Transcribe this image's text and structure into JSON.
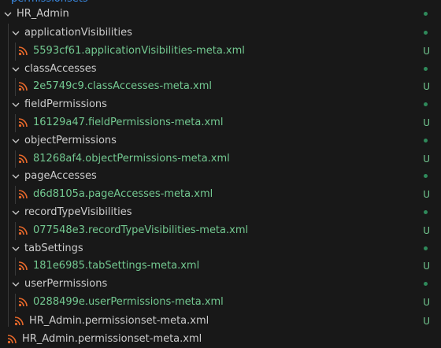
{
  "explorer": {
    "cutoff_label": "permissionsets",
    "root_folder": {
      "label": "HR_Admin",
      "icon": "chevron-down-icon"
    },
    "groups": [
      {
        "folder": "applicationVisibilities",
        "file": "5593cf61.applicationVisibilities-meta.xml",
        "status": "U"
      },
      {
        "folder": "classAccesses",
        "file": "2e5749c9.classAccesses-meta.xml",
        "status": "U"
      },
      {
        "folder": "fieldPermissions",
        "file": "16129a47.fieldPermissions-meta.xml",
        "status": "U"
      },
      {
        "folder": "objectPermissions",
        "file": "81268af4.objectPermissions-meta.xml",
        "status": "U"
      },
      {
        "folder": "pageAccesses",
        "file": "d6d8105a.pageAccesses-meta.xml",
        "status": "U"
      },
      {
        "folder": "recordTypeVisibilities",
        "file": "077548e3.recordTypeVisibilities-meta.xml",
        "status": "U"
      },
      {
        "folder": "tabSettings",
        "file": "181e6985.tabSettings-meta.xml",
        "status": "U"
      },
      {
        "folder": "userPermissions",
        "file": "0288499e.userPermissions-meta.xml",
        "status": "U"
      }
    ],
    "root_file": {
      "label": "HR_Admin.permissionset-meta.xml",
      "status": "U"
    },
    "outer_file": {
      "label": "HR_Admin.permissionset-meta.xml"
    },
    "colors": {
      "background": "#181818",
      "untracked": "#73c991",
      "rss_icon": "#e8692b",
      "modified_dot": "#2f8a5b"
    }
  }
}
